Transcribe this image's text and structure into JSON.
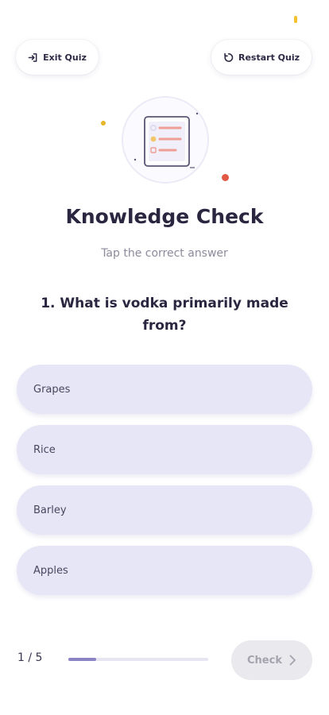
{
  "header": {
    "exit_label": "Exit Quiz",
    "restart_label": "Restart Quiz"
  },
  "quiz": {
    "title": "Knowledge Check",
    "subtitle": "Tap the correct answer",
    "question": "1. What is vodka primarily made from?",
    "options": [
      "Grapes",
      "Rice",
      "Barley",
      "Apples"
    ]
  },
  "footer": {
    "progress_text": "1 / 5",
    "progress_fraction": 0.2,
    "check_label": "Check"
  },
  "colors": {
    "accent": "#8a84c4",
    "option_bg": "#e7e6f6",
    "check_disabled_bg": "#e9e9ee"
  }
}
